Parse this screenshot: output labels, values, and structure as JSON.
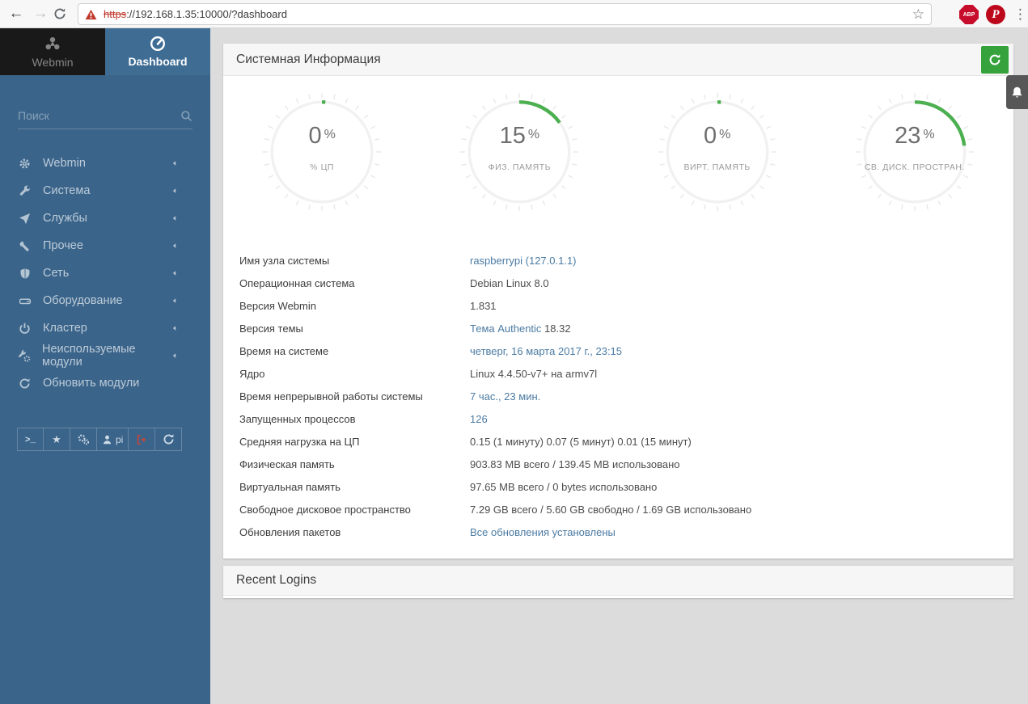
{
  "browser": {
    "url_scheme": "https",
    "url_rest": "://192.168.1.35:10000/?dashboard",
    "extensions": {
      "adblock_label": "ABP",
      "pinterest_label": "P"
    }
  },
  "sidebar": {
    "tabs": [
      {
        "id": "webmin",
        "label": "Webmin",
        "icon": "webmin-logo-icon"
      },
      {
        "id": "dashboard",
        "label": "Dashboard",
        "icon": "dashboard-icon"
      }
    ],
    "search_placeholder": "Поиск",
    "items": [
      {
        "id": "webmin",
        "icon": "gear-icon",
        "label": "Webmin",
        "caret": true
      },
      {
        "id": "system",
        "icon": "wrench-icon",
        "label": "Система",
        "caret": true
      },
      {
        "id": "services",
        "icon": "paper-plane-icon",
        "label": "Службы",
        "caret": true
      },
      {
        "id": "others",
        "icon": "spanner-icon",
        "label": "Прочее",
        "caret": true
      },
      {
        "id": "networking",
        "icon": "shield-icon",
        "label": "Сеть",
        "caret": true
      },
      {
        "id": "hardware",
        "icon": "hdd-icon",
        "label": "Оборудование",
        "caret": true
      },
      {
        "id": "cluster",
        "icon": "power-icon",
        "label": "Кластер",
        "caret": true
      },
      {
        "id": "unused-modules",
        "icon": "tools-icon",
        "label": "Неиспользуемые модули",
        "caret": true
      },
      {
        "id": "refresh-modules",
        "icon": "refresh-icon",
        "label": "Обновить модули",
        "caret": false
      }
    ],
    "footer_buttons": [
      {
        "id": "terminal",
        "icon": "terminal-icon"
      },
      {
        "id": "favorites",
        "icon": "star-icon"
      },
      {
        "id": "settings",
        "icon": "gears-icon"
      },
      {
        "id": "user",
        "icon": "user-icon",
        "label": "pi"
      },
      {
        "id": "logout",
        "icon": "logout-icon",
        "color": "#cb4437"
      },
      {
        "id": "refresh",
        "icon": "refresh-icon"
      }
    ]
  },
  "main": {
    "title": "Системная Информация",
    "gauges": [
      {
        "id": "cpu",
        "value": 0,
        "display": "0",
        "unit": "%",
        "label": "ЦП",
        "label_icon": "percent-icon"
      },
      {
        "id": "phys-memory",
        "value": 15,
        "display": "15",
        "unit": "%",
        "label": "ФИЗ. ПАМЯТЬ"
      },
      {
        "id": "virt-memory",
        "value": 0,
        "display": "0",
        "unit": "%",
        "label": "ВИРТ. ПАМЯТЬ"
      },
      {
        "id": "disk-space",
        "value": 23,
        "display": "23",
        "unit": "%",
        "label": "СВ. ДИСК. ПРОСТРАН."
      }
    ],
    "info_rows": [
      {
        "label": "Имя узла системы",
        "parts": [
          {
            "text": "raspberrypi (127.0.1.1)",
            "link": true
          }
        ]
      },
      {
        "label": "Операционная система",
        "parts": [
          {
            "text": "Debian Linux 8.0",
            "link": false
          }
        ]
      },
      {
        "label": "Версия Webmin",
        "parts": [
          {
            "text": "1.831",
            "link": false
          }
        ]
      },
      {
        "label": "Версия темы",
        "parts": [
          {
            "text": "Тема Authentic",
            "link": true
          },
          {
            "text": " 18.32",
            "link": false
          }
        ]
      },
      {
        "label": "Время на системе",
        "parts": [
          {
            "text": "четверг, 16 марта 2017 г., 23:15",
            "link": true
          }
        ]
      },
      {
        "label": "Ядро",
        "parts": [
          {
            "text": "Linux 4.4.50-v7+ на armv7l",
            "link": false
          }
        ]
      },
      {
        "label": "Время непрерывной работы системы",
        "parts": [
          {
            "text": "7 час., 23 мин.",
            "link": true
          }
        ]
      },
      {
        "label": "Запущенных процессов",
        "parts": [
          {
            "text": "126",
            "link": true
          }
        ]
      },
      {
        "label": "Средняя нагрузка на ЦП",
        "parts": [
          {
            "text": "0.15 (1 минуту) 0.07 (5 минут) 0.01 (15 минут)",
            "link": false
          }
        ]
      },
      {
        "label": "Физическая память",
        "parts": [
          {
            "text": "903.83 MB всего / 139.45 MB использовано",
            "link": false
          }
        ]
      },
      {
        "label": "Виртуальная память",
        "parts": [
          {
            "text": "97.65 MB всего / 0 bytes использовано",
            "link": false
          }
        ]
      },
      {
        "label": "Свободное дисковое пространство",
        "parts": [
          {
            "text": "7.29 GB всего / 5.60 GB свободно / 1.69 GB использовано",
            "link": false
          }
        ]
      },
      {
        "label": "Обновления пакетов",
        "parts": [
          {
            "text": "Все обновления установлены",
            "link": true
          }
        ]
      }
    ],
    "recent_logins_title": "Recent Logins"
  },
  "colors": {
    "accent_green": "#35a23c",
    "gauge_green": "#4caf50",
    "sidebar_blue": "#3b648a",
    "link_blue": "#4b7ba3",
    "logout_red": "#cb4437",
    "url_error_red": "#c0392b",
    "adblock_red": "#c70d2c",
    "pinterest_red": "#bd081c"
  }
}
